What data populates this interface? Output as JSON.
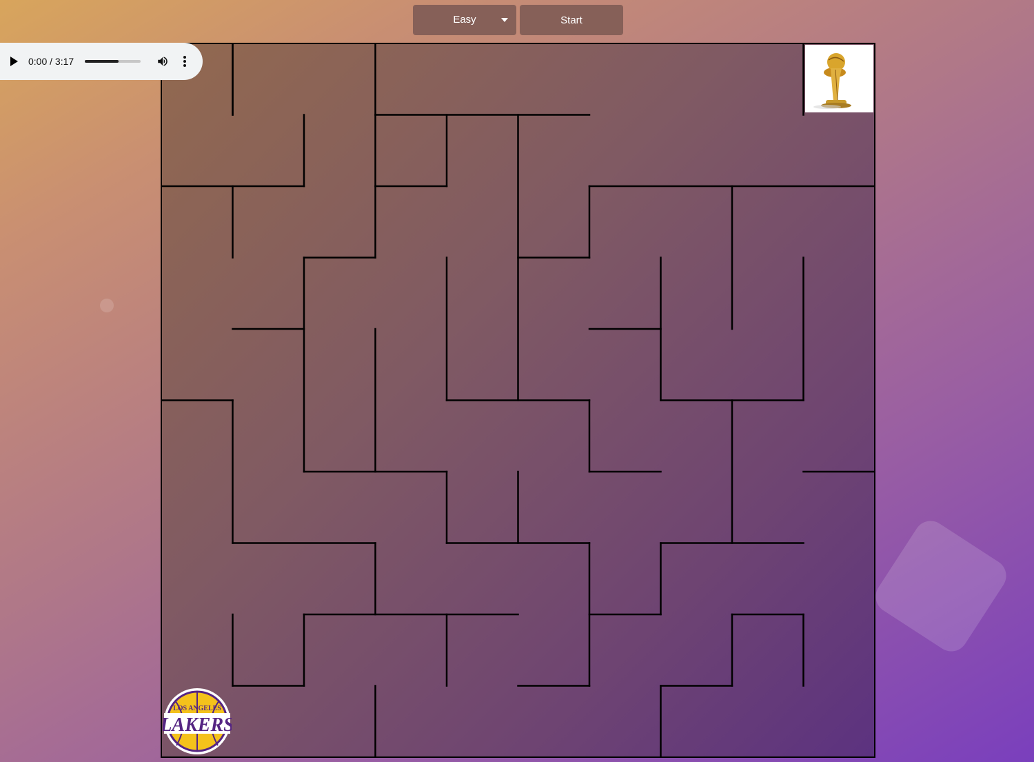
{
  "toolbar": {
    "difficulty": {
      "selected": "Easy",
      "icon": "chevron-down-icon"
    },
    "start_label": "Start"
  },
  "audio": {
    "time": "0:00 / 3:17",
    "progress": 0.6,
    "icons": [
      "play-icon",
      "volume-icon",
      "more-vert-icon"
    ]
  },
  "maze": {
    "walls": [
      [
        1,
        0,
        1,
        1
      ],
      [
        3,
        1,
        6,
        1
      ],
      [
        0,
        2,
        2,
        2
      ],
      [
        3,
        2,
        4,
        2
      ],
      [
        6,
        2,
        10,
        2
      ],
      [
        2,
        3,
        3,
        3
      ],
      [
        5,
        3,
        6,
        3
      ],
      [
        1,
        4,
        2,
        4
      ],
      [
        6,
        4,
        7,
        4
      ],
      [
        0,
        5,
        1,
        5
      ],
      [
        4,
        5,
        6,
        5
      ],
      [
        7,
        5,
        9,
        5
      ],
      [
        2,
        6,
        4,
        6
      ],
      [
        6,
        6,
        7,
        6
      ],
      [
        9,
        6,
        10,
        6
      ],
      [
        1,
        7,
        3,
        7
      ],
      [
        4,
        7,
        6,
        7
      ],
      [
        7,
        7,
        9,
        7
      ],
      [
        2,
        8,
        5,
        8
      ],
      [
        6,
        8,
        7,
        8
      ],
      [
        8,
        8,
        9,
        8
      ],
      [
        1,
        9,
        2,
        9
      ],
      [
        5,
        9,
        6,
        9
      ],
      [
        7,
        9,
        8,
        9
      ],
      [
        1,
        0,
        1,
        1
      ],
      [
        1,
        2,
        1,
        3
      ],
      [
        1,
        5,
        1,
        7
      ],
      [
        1,
        8,
        1,
        9
      ],
      [
        2,
        1,
        2,
        2
      ],
      [
        2,
        3,
        2,
        6
      ],
      [
        2,
        8,
        2,
        9
      ],
      [
        3,
        0,
        3,
        3
      ],
      [
        3,
        4,
        3,
        6
      ],
      [
        3,
        7,
        3,
        8
      ],
      [
        3,
        9,
        3,
        10
      ],
      [
        4,
        1,
        4,
        2
      ],
      [
        4,
        3,
        4,
        5
      ],
      [
        4,
        6,
        4,
        7
      ],
      [
        4,
        8,
        4,
        9
      ],
      [
        5,
        1,
        5,
        5
      ],
      [
        5,
        6,
        5,
        7
      ],
      [
        6,
        2,
        6,
        3
      ],
      [
        6,
        5,
        6,
        6
      ],
      [
        6,
        7,
        6,
        9
      ],
      [
        7,
        3,
        7,
        5
      ],
      [
        7,
        7,
        7,
        8
      ],
      [
        7,
        9,
        7,
        10
      ],
      [
        8,
        2,
        8,
        4
      ],
      [
        8,
        5,
        8,
        7
      ],
      [
        8,
        8,
        8,
        9
      ],
      [
        9,
        0,
        9,
        1
      ],
      [
        9,
        3,
        9,
        5
      ],
      [
        9,
        8,
        9,
        9
      ]
    ],
    "start_icon": "lakers-logo-icon",
    "goal_icon": "trophy-icon"
  }
}
